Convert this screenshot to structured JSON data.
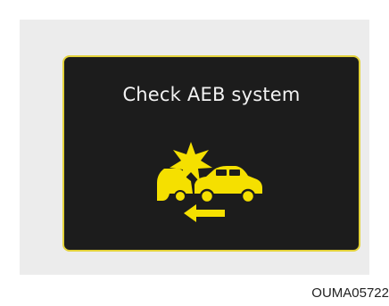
{
  "display": {
    "message": "Check AEB system",
    "icon": "aeb-collision-warning-icon",
    "icon_color": "#f5e000",
    "border_color": "#e3d23a",
    "background_color": "#1c1c1c"
  },
  "caption": "OUMA05722"
}
